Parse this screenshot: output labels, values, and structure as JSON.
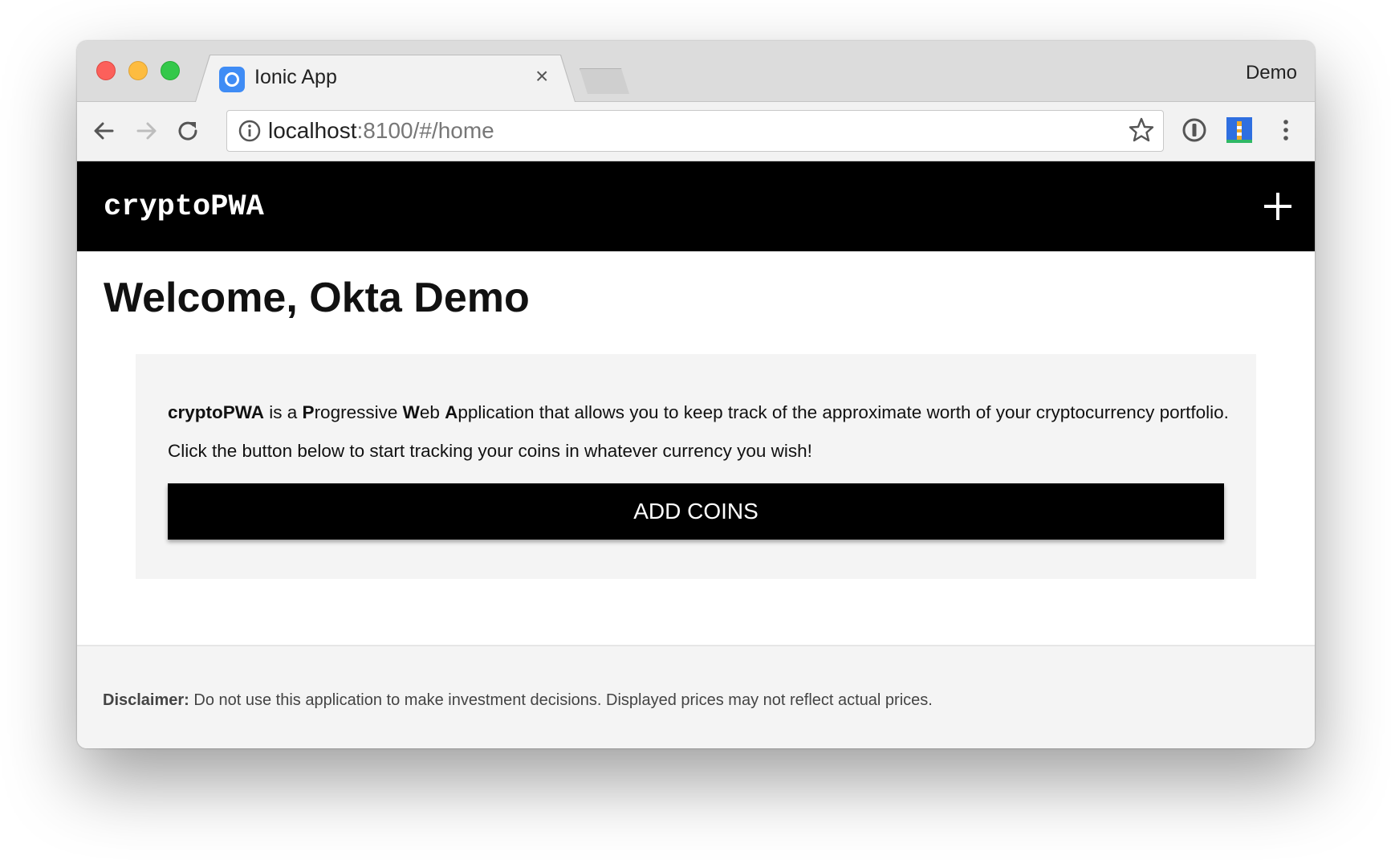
{
  "browser": {
    "tab_title": "Ionic App",
    "tab_close": "×",
    "profile_name": "Demo",
    "url_host": "localhost",
    "url_rest": ":8100/#/home"
  },
  "app": {
    "title": "cryptoPWA"
  },
  "home": {
    "welcome": "Welcome, Okta Demo",
    "intro": {
      "app_name": "cryptoPWA",
      "is_a": " is a ",
      "p": "P",
      "rogressive": "rogressive ",
      "w": "W",
      "eb": "eb ",
      "a": "A",
      "rest": "pplication that allows you to keep track of the approximate worth of your cryptocurrency portfolio."
    },
    "instructions": "Click the button below to start tracking your coins in whatever currency you wish!",
    "button_label": "ADD COINS"
  },
  "footer": {
    "disclaimer_label": "Disclaimer:",
    "disclaimer_text": " Do not use this application to make investment decisions. Displayed prices may not reflect actual prices."
  }
}
